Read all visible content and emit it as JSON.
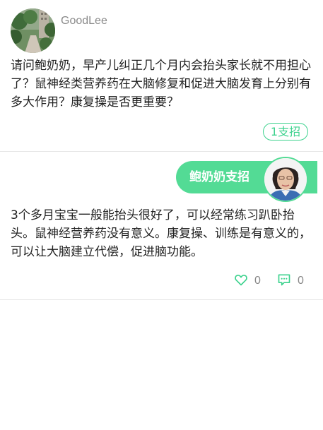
{
  "question": {
    "username": "GoodLee",
    "text": "请问鲍奶奶，早产儿纠正几个月内会抬头家长就不用担心了？鼠神经类营养药在大脑修复和促进大脑发育上分别有多大作用？康复操是否更重要？",
    "support_label": "1支招"
  },
  "answer": {
    "banner_label": "鲍奶奶支招",
    "text": "3个多月宝宝一般能抬头很好了，可以经常练习趴卧抬头。鼠神经营养药没有意义。康复操、训练是有意义的，可以让大脑建立代偿，促进脑功能。",
    "like_count": "0",
    "comment_count": "0"
  },
  "colors": {
    "accent": "#53db95",
    "accent_text": "#3dd28e"
  },
  "icons": {
    "like": "heart-outline-icon",
    "comment": "speech-bubble-dots-icon"
  }
}
